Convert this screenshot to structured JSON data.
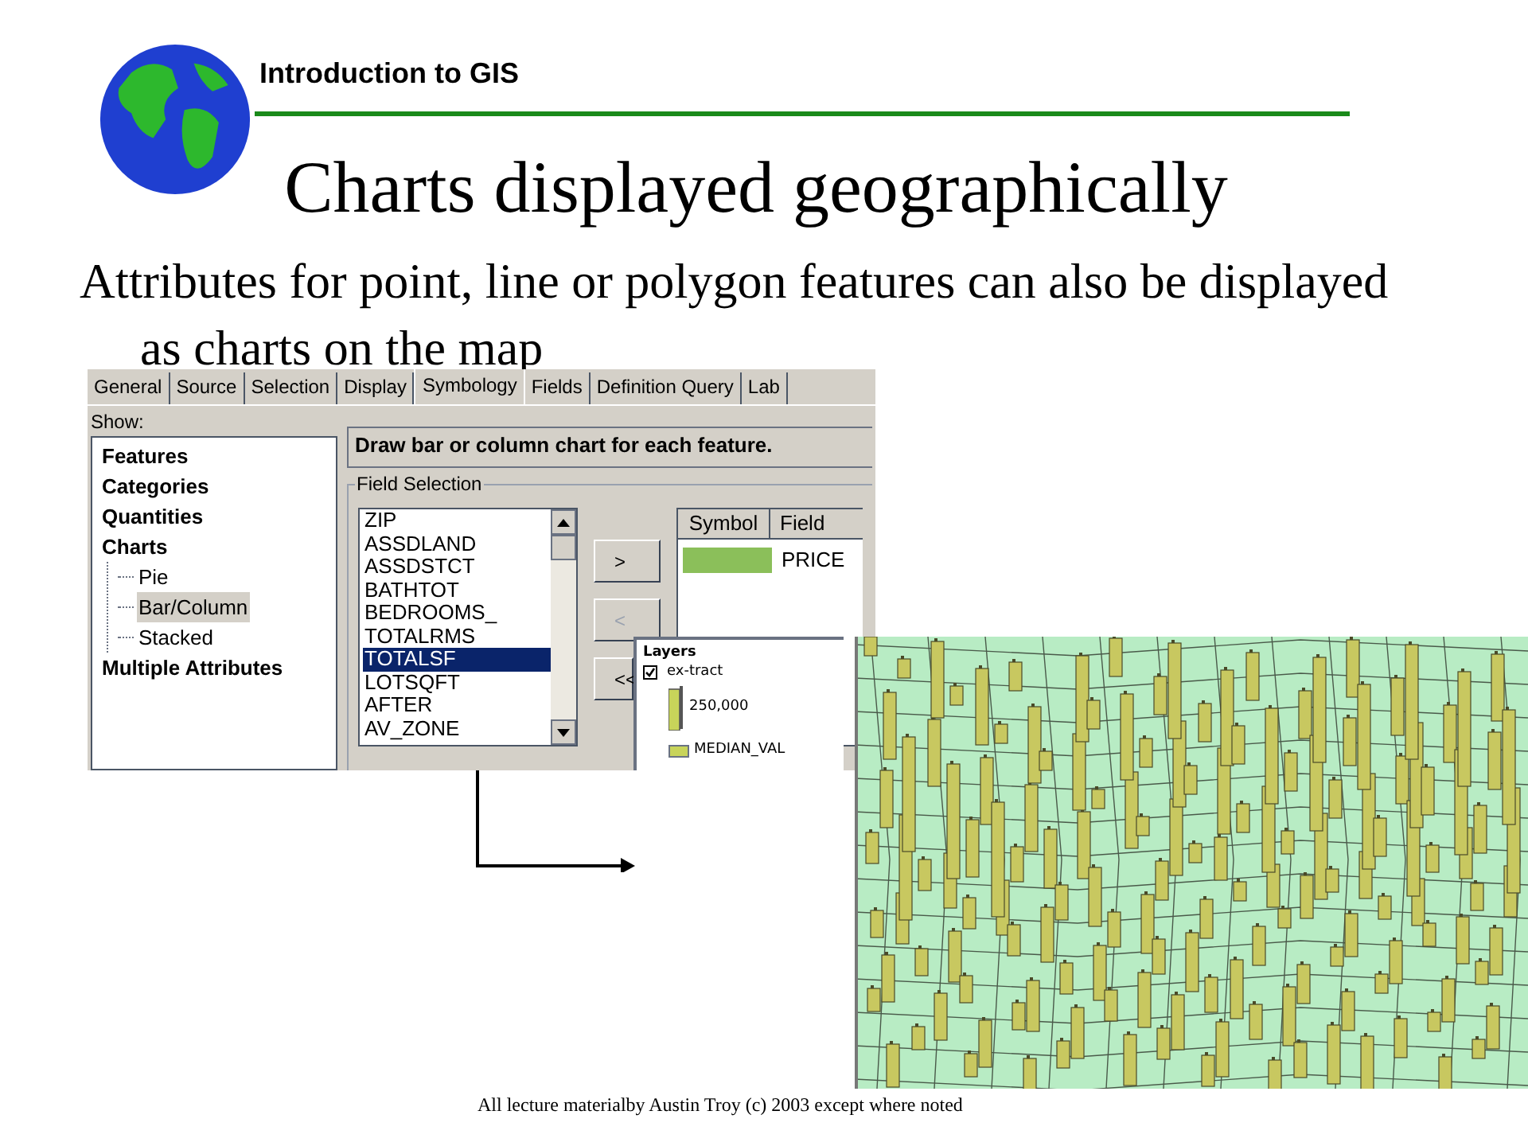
{
  "header": {
    "course": "Introduction to GIS"
  },
  "title": "Charts displayed geographically",
  "bullet": "Attributes for point, line or polygon features can also be displayed as charts on the map",
  "dialog": {
    "tabs": [
      {
        "label": "General",
        "selected": false
      },
      {
        "label": "Source",
        "selected": false
      },
      {
        "label": "Selection",
        "selected": false
      },
      {
        "label": "Display",
        "selected": false
      },
      {
        "label": "Symbology",
        "selected": true
      },
      {
        "label": "Fields",
        "selected": false
      },
      {
        "label": "Definition Query",
        "selected": false
      },
      {
        "label": "Lab",
        "selected": false
      }
    ],
    "show_label": "Show:",
    "tree": [
      {
        "label": "Features",
        "selected": false
      },
      {
        "label": "Categories",
        "selected": false
      },
      {
        "label": "Quantities",
        "selected": false
      },
      {
        "label": "Charts",
        "selected": false,
        "children": [
          {
            "label": "Pie",
            "selected": false
          },
          {
            "label": "Bar/Column",
            "selected": true
          },
          {
            "label": "Stacked",
            "selected": false
          }
        ]
      },
      {
        "label": "Multiple Attributes",
        "selected": false
      }
    ],
    "description": "Draw bar or column chart for each feature.",
    "field_selection": {
      "legend": "Field Selection",
      "fields": [
        {
          "label": "ZIP",
          "selected": false
        },
        {
          "label": "ASSDLAND",
          "selected": false
        },
        {
          "label": "ASSDSTCT",
          "selected": false
        },
        {
          "label": "BATHTOT",
          "selected": false
        },
        {
          "label": "BEDROOMS_",
          "selected": false
        },
        {
          "label": "TOTALRMS",
          "selected": false
        },
        {
          "label": "TOTALSF",
          "selected": true
        },
        {
          "label": "LOTSQFT",
          "selected": false
        },
        {
          "label": "AFTER",
          "selected": false
        },
        {
          "label": "AV_ZONE",
          "selected": false
        }
      ],
      "buttons": [
        {
          "label": ">",
          "disabled": false
        },
        {
          "label": "<",
          "disabled": true
        },
        {
          "label": "<<",
          "disabled": false
        }
      ],
      "columns": [
        "Symbol",
        "Field"
      ],
      "rows": [
        {
          "color": "#8bbf5a",
          "field": "PRICE"
        }
      ]
    }
  },
  "legend": {
    "title": "Layers",
    "layer": {
      "label": "ex-tract",
      "checked": true
    },
    "size_label": "250,000",
    "field_label": "MEDIAN_VAL"
  },
  "footer": "All lecture materialby Austin Troy (c) 2003 except where noted"
}
